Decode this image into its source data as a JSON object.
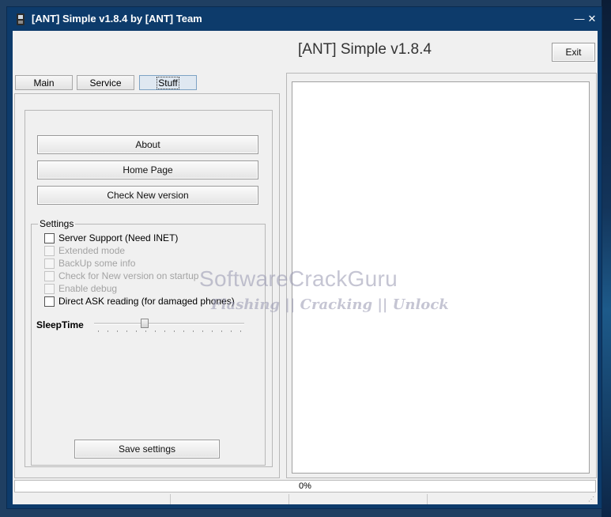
{
  "window": {
    "title": "[ANT] Simple v1.8.4 by [ANT] Team",
    "minimize_glyph": "—",
    "close_glyph": "✕"
  },
  "header": {
    "app_title": "[ANT] Simple v1.8.4",
    "exit_label": "Exit"
  },
  "tabs": [
    {
      "label": "Main",
      "active": false
    },
    {
      "label": "Service",
      "active": false
    },
    {
      "label": "Stuff",
      "active": true
    }
  ],
  "stuff": {
    "about_label": "About",
    "homepage_label": "Home Page",
    "check_version_label": "Check New version",
    "settings_title": "Settings",
    "options": [
      {
        "label": "Server Support (Need INET)",
        "enabled": true,
        "checked": false
      },
      {
        "label": "Extended mode",
        "enabled": false,
        "checked": false
      },
      {
        "label": "BackUp some info",
        "enabled": false,
        "checked": false
      },
      {
        "label": "Check for New version on startup",
        "enabled": false,
        "checked": false
      },
      {
        "label": "Enable debug",
        "enabled": false,
        "checked": false
      },
      {
        "label": "Direct ASK reading (for damaged phones)",
        "enabled": true,
        "checked": false
      }
    ],
    "sleeptime_label": "SleepTime",
    "sleeptime_level_fraction": 0.33,
    "save_label": "Save settings"
  },
  "progress": {
    "text": "0%",
    "value": 0
  },
  "watermark": {
    "title": "SoftwareCrackGuru",
    "subtitle": "Flashing || Cracking || Unlock"
  },
  "colors": {
    "titlebar": "#0d3b6b",
    "client": "#f0f0f0",
    "active_tab": "#dfe8f1"
  }
}
